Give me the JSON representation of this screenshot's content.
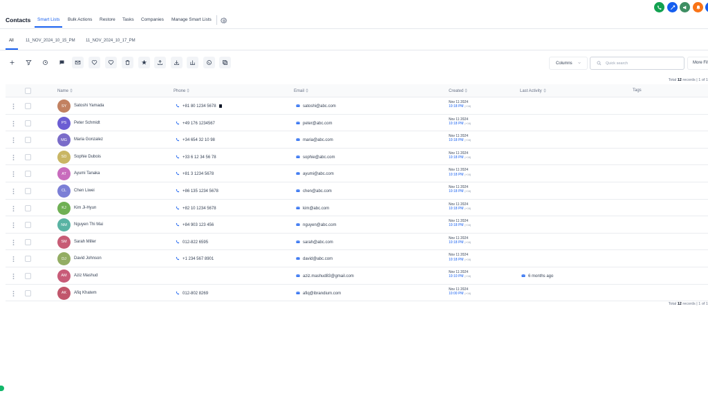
{
  "header": {
    "title": "Contacts",
    "nav": [
      "Smart Lists",
      "Bulk Actions",
      "Restore",
      "Tasks",
      "Companies",
      "Manage Smart Lists"
    ],
    "icons": [
      {
        "name": "phone-icon",
        "color": "#12a150"
      },
      {
        "name": "dispatch-icon",
        "color": "#155eef"
      },
      {
        "name": "megaphone-icon",
        "color": "#3e8e63"
      },
      {
        "name": "bell-icon",
        "color": "#f97316"
      },
      {
        "name": "avatar-partial",
        "color": "#155eef"
      }
    ]
  },
  "subtabs": [
    "All",
    "11_NOV_2024_10_15_PM",
    "11_NOV_2024_10_17_PM"
  ],
  "toolbar": {
    "icons": [
      "plus-icon",
      "filter-icon",
      "workflow-icon",
      "message-icon",
      "mail-icon",
      "heart-add-icon",
      "heart-remove-icon",
      "trash-icon",
      "star-icon",
      "export-icon",
      "import-icon",
      "merge-icon",
      "whatsapp-icon",
      "duplicate-icon"
    ],
    "columns_label": "Columns",
    "search_placeholder": "Quick search",
    "more_filters_label": "More Filters"
  },
  "pagination": {
    "prefix": "Total",
    "count": "12",
    "suffix": "records | 1 of 1"
  },
  "table": {
    "headers": [
      "Name",
      "Phone",
      "Email",
      "Created",
      "Last Activity",
      "Tags"
    ],
    "rows": [
      {
        "initials": "SY",
        "color": "#c28161",
        "name": "Satoshi Yamada",
        "phone": "+81 80 1234 5678",
        "email": "satoshi@abc.com",
        "date": "Nov 11 2024",
        "time": "10:18 PM",
        "tz": "(+08)",
        "activity": ""
      },
      {
        "initials": "PS",
        "color": "#6b5dd3",
        "name": "Peter Schmidt",
        "phone": "+49 176 1234567",
        "email": "peter@abc.com",
        "date": "Nov 11 2024",
        "time": "10:18 PM",
        "tz": "(+08)",
        "activity": ""
      },
      {
        "initials": "MG",
        "color": "#7a6cc9",
        "name": "Maria Gonzalez",
        "phone": "+34 654 32 10 98",
        "email": "maria@abc.com",
        "date": "Nov 11 2024",
        "time": "10:18 PM",
        "tz": "(+08)",
        "activity": ""
      },
      {
        "initials": "SD",
        "color": "#c9b664",
        "name": "Sophie Dubois",
        "phone": "+33 6 12 34 56 78",
        "email": "sophie@abc.com",
        "date": "Nov 11 2024",
        "time": "10:18 PM",
        "tz": "(+08)",
        "activity": ""
      },
      {
        "initials": "AT",
        "color": "#c86bbd",
        "name": "Ayumi Tanaka",
        "phone": "+81 3 1234 5678",
        "email": "ayumi@abc.com",
        "date": "Nov 11 2024",
        "time": "10:18 PM",
        "tz": "(+08)",
        "activity": ""
      },
      {
        "initials": "CL",
        "color": "#7b7fd6",
        "name": "Chen Liwei",
        "phone": "+86 135 1234 5678",
        "email": "chen@abc.com",
        "date": "Nov 11 2024",
        "time": "10:18 PM",
        "tz": "(+08)",
        "activity": ""
      },
      {
        "initials": "KJ",
        "color": "#6fb054",
        "name": "Kim Ji-Hyun",
        "phone": "+82 10 1234 5678",
        "email": "kim@abc.com",
        "date": "Nov 11 2024",
        "time": "10:18 PM",
        "tz": "(+08)",
        "activity": ""
      },
      {
        "initials": "NM",
        "color": "#59b3a3",
        "name": "Nguyen Thi Mai",
        "phone": "+84 903 123 456",
        "email": "nguyen@abc.com",
        "date": "Nov 11 2024",
        "time": "10:18 PM",
        "tz": "(+08)",
        "activity": ""
      },
      {
        "initials": "SM",
        "color": "#c75c75",
        "name": "Sarah Miller",
        "phone": "012-822 6595",
        "email": "sarah@abc.com",
        "date": "Nov 11 2024",
        "time": "10:18 PM",
        "tz": "(+08)",
        "activity": ""
      },
      {
        "initials": "DJ",
        "color": "#93ad63",
        "name": "David Johnson",
        "phone": "+1 234 567 8901",
        "email": "david@abc.com",
        "date": "Nov 11 2024",
        "time": "10:18 PM",
        "tz": "(+08)",
        "activity": ""
      },
      {
        "initials": "AM",
        "color": "#c85b78",
        "name": "Aziz Mashud",
        "phone": "",
        "email": "aziz.mashud83@gmail.com",
        "date": "Nov 11 2024",
        "time": "10:10 PM",
        "tz": "(+08)",
        "activity": "6 months ago"
      },
      {
        "initials": "AK",
        "color": "#c1566b",
        "name": "Afiq Khatem",
        "phone": "012-802 8269",
        "email": "afiq@ibrandium.com",
        "date": "Nov 11 2024",
        "time": "10:00 PM",
        "tz": "(+08)",
        "activity": ""
      }
    ]
  }
}
